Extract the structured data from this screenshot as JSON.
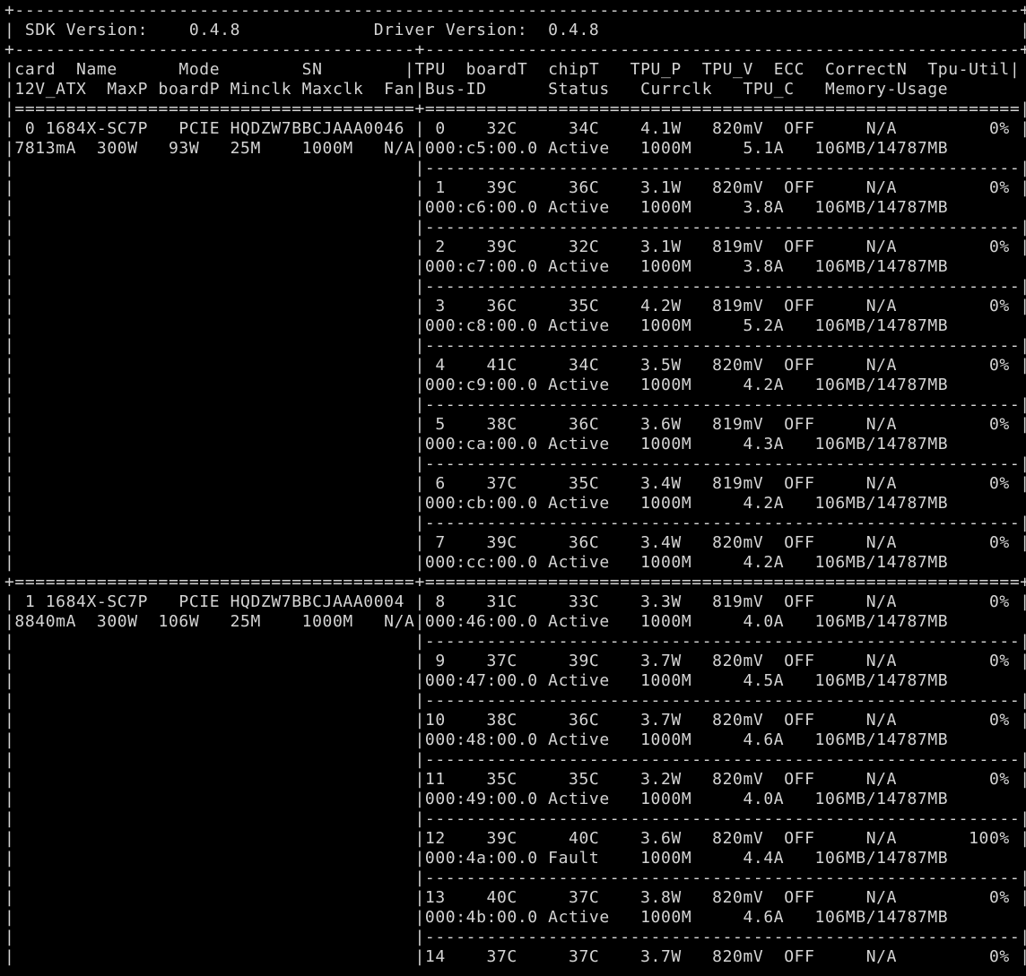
{
  "window": {
    "background": "#000000",
    "text_color": "#d4d4d4",
    "cursor_color": "#18e040"
  },
  "terminal": {
    "lines": [
      "+--------------------------------------------------------------------------------------------------+",
      "| SDK Version:    0.4.8             Driver Version:  0.4.8                                         |",
      "+---------------------------------------+----------------------------------------------------------+",
      "|card  Name      Mode        SN        |TPU  boardT  chipT   TPU_P  TPU_V  ECC  CorrectN  Tpu-Util|",
      "|12V_ATX  MaxP boardP Minclk Maxclk  Fan|Bus-ID      Status   Currclk   TPU_C   Memory-Usage        |",
      "|=======================================+==========================================================|",
      "| 0 1684X-SC7P   PCIE HQDZW7BBCJAAA0046 | 0    32C     34C    4.1W   820mV  OFF     N/A         0% |",
      "|7813mA  300W   93W   25M    1000M   N/A|000:c5:00.0 Active   1000M     5.1A   106MB/14787MB        |",
      "|                                       |----------------------------------------------------------|",
      "|                                       | 1    39C     36C    3.1W   820mV  OFF     N/A         0% |",
      "|                                       |000:c6:00.0 Active   1000M     3.8A   106MB/14787MB        |",
      "|                                       |----------------------------------------------------------|",
      "|                                       | 2    39C     32C    3.1W   819mV  OFF     N/A         0% |",
      "|                                       |000:c7:00.0 Active   1000M     3.8A   106MB/14787MB        |",
      "|                                       |----------------------------------------------------------|",
      "|                                       | 3    36C     35C    4.2W   819mV  OFF     N/A         0% |",
      "|                                       |000:c8:00.0 Active   1000M     5.2A   106MB/14787MB        |",
      "|                                       |----------------------------------------------------------|",
      "|                                       | 4    41C     34C    3.5W   820mV  OFF     N/A         0% |",
      "|                                       |000:c9:00.0 Active   1000M     4.2A   106MB/14787MB        |",
      "|                                       |----------------------------------------------------------|",
      "|                                       | 5    38C     36C    3.6W   819mV  OFF     N/A         0% |",
      "|                                       |000:ca:00.0 Active   1000M     4.3A   106MB/14787MB        |",
      "|                                       |----------------------------------------------------------|",
      "|                                       | 6    37C     35C    3.4W   819mV  OFF     N/A         0% |",
      "|                                       |000:cb:00.0 Active   1000M     4.2A   106MB/14787MB        |",
      "|                                       |----------------------------------------------------------|",
      "|                                       | 7    39C     36C    3.4W   820mV  OFF     N/A         0% |",
      "|                                       |000:cc:00.0 Active   1000M     4.2A   106MB/14787MB        |",
      "+=======================================+==========================================================+",
      "| 1 1684X-SC7P   PCIE HQDZW7BBCJAAA0004 | 8    31C     33C    3.3W   819mV  OFF     N/A         0% |",
      "|8840mA  300W  106W   25M    1000M   N/A|000:46:00.0 Active   1000M     4.0A   106MB/14787MB        |",
      "|                                       |----------------------------------------------------------|",
      "|                                       | 9    37C     39C    3.7W   820mV  OFF     N/A         0% |",
      "|                                       |000:47:00.0 Active   1000M     4.5A   106MB/14787MB        |",
      "|                                       |----------------------------------------------------------|",
      "|                                       |10    38C     36C    3.7W   820mV  OFF     N/A         0% |",
      "|                                       |000:48:00.0 Active   1000M     4.6A   106MB/14787MB        |",
      "|                                       |----------------------------------------------------------|",
      "|                                       |11    35C     35C    3.2W   820mV  OFF     N/A         0% |",
      "|                                       |000:49:00.0 Active   1000M     4.0A   106MB/14787MB        |",
      "|                                       |----------------------------------------------------------|",
      "|                                       |12    39C     40C    3.6W   820mV  OFF     N/A       100% |",
      "|                                       |000:4a:00.0 Fault    1000M     4.4A   106MB/14787MB        |",
      "|                                       |----------------------------------------------------------|",
      "|                                       |13    40C     37C    3.8W   820mV  OFF     N/A         0% |",
      "|                                       |000:4b:00.0 Active   1000M     4.6A   106MB/14787MB        |",
      "|                                       |----------------------------------------------------------|",
      "|                                       |14    37C     37C    3.7W   820mV  OFF     N/A         0% |"
    ]
  }
}
